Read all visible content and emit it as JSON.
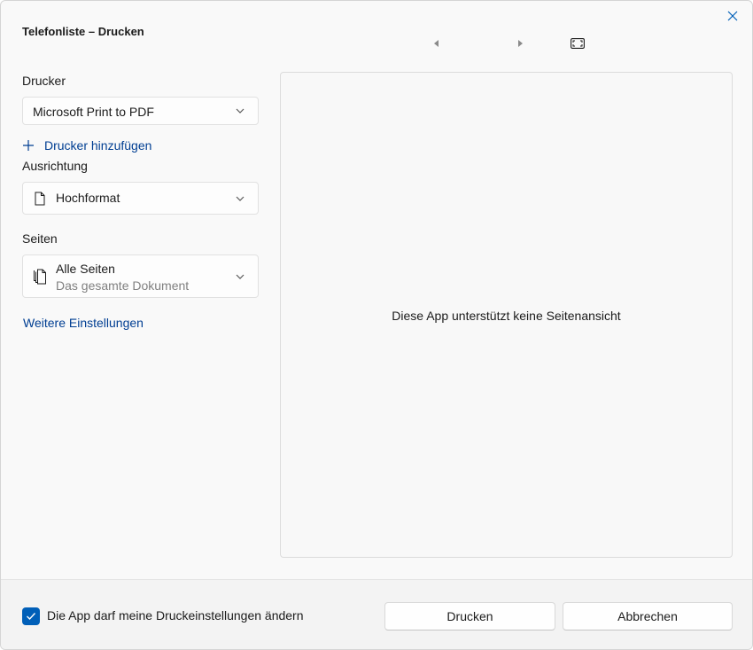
{
  "window": {
    "title": "Telefonliste – Drucken",
    "close_icon": "close-icon"
  },
  "preview_nav": {
    "prev_icon": "triangle-left-icon",
    "next_icon": "triangle-right-icon",
    "fit_icon": "fit-to-screen-icon"
  },
  "printer": {
    "label": "Drucker",
    "selected": "Microsoft Print to PDF",
    "add_printer_label": "Drucker hinzufügen"
  },
  "orientation": {
    "label": "Ausrichtung",
    "selected": "Hochformat",
    "icon": "page-icon"
  },
  "pages": {
    "label": "Seiten",
    "selected": "Alle Seiten",
    "selected_description": "Das gesamte Dokument",
    "icon": "multiple-pages-icon"
  },
  "more_settings_label": "Weitere Einstellungen",
  "preview": {
    "message": "Diese App unterstützt keine Seitenansicht"
  },
  "footer": {
    "checkbox_checked": true,
    "checkbox_label": "Die App darf meine Druckeinstellungen ändern",
    "print_label": "Drucken",
    "cancel_label": "Abbrechen"
  },
  "colors": {
    "accent": "#005fb8",
    "link": "#003e92"
  }
}
